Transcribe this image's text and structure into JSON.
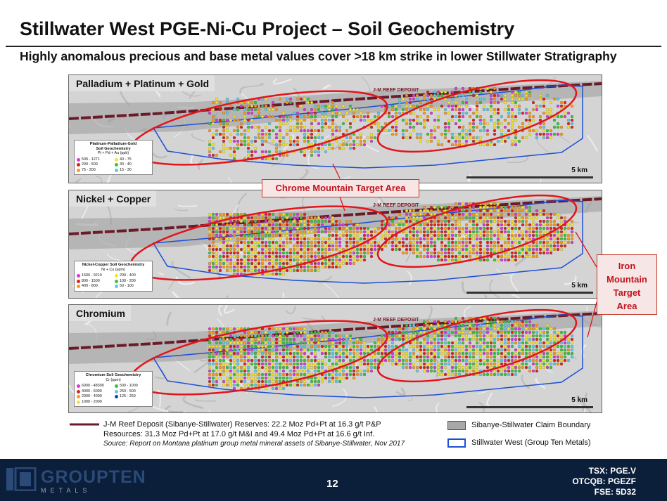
{
  "slide": {
    "title": "Stillwater West PGE-Ni-Cu Project – Soil Geochemistry",
    "subtitle": "Highly anomalous precious and base metal values cover >18 km strike in lower Stillwater Stratigraphy",
    "page_number": "12"
  },
  "panels": [
    {
      "label": "Palladium + Platinum + Gold",
      "reef_label": "J-M REEF DEPOSIT",
      "scale": "5 km",
      "legend": {
        "title": "Platinum-Palladium-Gold",
        "title2": "Soil Geochemistry",
        "units": "Pt + Pd + Au (ppb)",
        "items": [
          {
            "label": "500 - 1271",
            "color": "#d63bd6"
          },
          {
            "label": "40 - 75",
            "color": "#f5e62a"
          },
          {
            "label": "200 - 500",
            "color": "#d9261c"
          },
          {
            "label": "30 - 40",
            "color": "#3cc43c"
          },
          {
            "label": "75 - 200",
            "color": "#f59a1e"
          },
          {
            "label": "15 - 30",
            "color": "#5fc9e8"
          }
        ]
      }
    },
    {
      "label": "Nickel + Copper",
      "reef_label": "J-M REEF DEPOSIT",
      "scale": "5 km",
      "legend": {
        "title": "Nickel-Copper Soil Geochemistry",
        "title2": "",
        "units": "Ni + Cu (ppm)",
        "items": [
          {
            "label": "1500 - 9210",
            "color": "#d63bd6"
          },
          {
            "label": "200 - 400",
            "color": "#f5e62a"
          },
          {
            "label": "800 - 1500",
            "color": "#d9261c"
          },
          {
            "label": "100 - 200",
            "color": "#3cc43c"
          },
          {
            "label": "400 - 800",
            "color": "#f59a1e"
          },
          {
            "label": "50 - 100",
            "color": "#5fc9e8"
          }
        ]
      }
    },
    {
      "label": "Chromium",
      "reef_label": "J-M REEF DEPOSIT",
      "scale": "5 km",
      "legend": {
        "title": "Chromium Soil Geochemistry",
        "title2": "",
        "units": "Cr (ppm)",
        "items": [
          {
            "label": "6000 - 48300",
            "color": "#d63bd6"
          },
          {
            "label": "500 - 1000",
            "color": "#3cc43c"
          },
          {
            "label": "4000 - 6000",
            "color": "#d9261c"
          },
          {
            "label": "250 - 500",
            "color": "#5fc9e8"
          },
          {
            "label": "2000 - 4000",
            "color": "#f59a1e"
          },
          {
            "label": "125 - 250",
            "color": "#1f3fb8"
          },
          {
            "label": "1000 - 2000",
            "color": "#f5e62a"
          }
        ]
      }
    }
  ],
  "callouts": {
    "chrome_mountain": "Chrome Mountain Target Area",
    "iron_mountain": [
      "Iron",
      "Mountain",
      "Target",
      "Area"
    ]
  },
  "footer": {
    "reef_line1": "J-M Reef Deposit (Sibanye-Stillwater) Reserves: 22.2 Moz Pd+Pt at 16.3 g/t P&P",
    "reef_line2": "Resources:  31.3 Moz Pd+Pt at 17.0 g/t M&I and 49.4 Moz Pd+Pt at 16.6 g/t Inf.",
    "source": "Source: Report on Montana platinum group metal mineral assets of Sibanye-Stillwater, Nov 2017",
    "claim_boundary": "Sibanye-Stillwater Claim Boundary",
    "group_ten": "Stillwater West (Group Ten Metals)"
  },
  "branding": {
    "logo": "GROUPTEN",
    "logo_sub": "METALS",
    "tickers": [
      "TSX: PGE.V",
      "OTCQB: PGEZF",
      "FSE: 5D32"
    ]
  },
  "colors": {
    "reef": "#6b1a2a",
    "ellipse": "#e3141b",
    "boundary_blue": "#1d4fd6",
    "footer_bar": "#0b1e3a"
  }
}
